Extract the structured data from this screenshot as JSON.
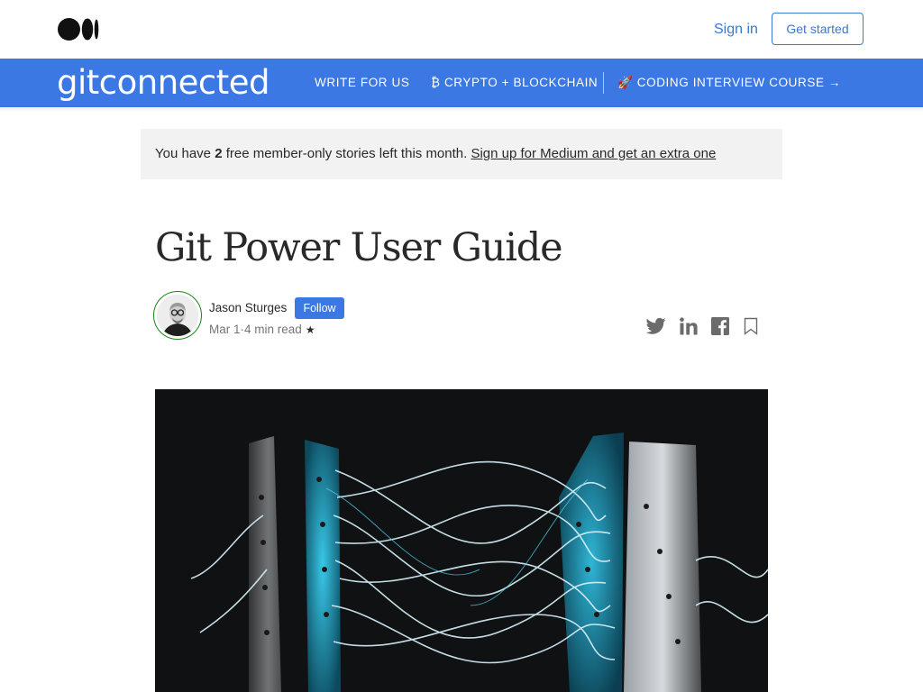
{
  "header": {
    "logo_icon": "medium-logo-icon",
    "sign_in": "Sign in",
    "get_started": "Get started"
  },
  "publication": {
    "name": "gitconnected",
    "nav": [
      {
        "label": "WRITE FOR US"
      },
      {
        "label": "₿ CRYPTO + BLOCKCHAIN"
      },
      {
        "label": "🚀 CODING INTERVIEW COURSE →"
      }
    ],
    "color": "#3b78e3"
  },
  "meter_banner": {
    "prefix": "You have ",
    "count": "2",
    "suffix": " free member-only stories left this month. ",
    "link": "Sign up for Medium and get an extra one"
  },
  "article": {
    "title": "Git Power User Guide",
    "author": "Jason Sturges",
    "follow_label": "Follow",
    "date": "Mar 1",
    "separator": "·",
    "read_time": "4 min read",
    "member_star": "★",
    "share_icons": [
      "twitter-icon",
      "linkedin-icon",
      "facebook-icon",
      "bookmark-icon"
    ],
    "hero_image": "glowing-cables-between-metal-panels"
  },
  "colors": {
    "accent": "#3b78e3",
    "link": "#3b78cf",
    "text": "#292929",
    "muted": "#757575",
    "banner_bg": "#f2f2f2"
  }
}
